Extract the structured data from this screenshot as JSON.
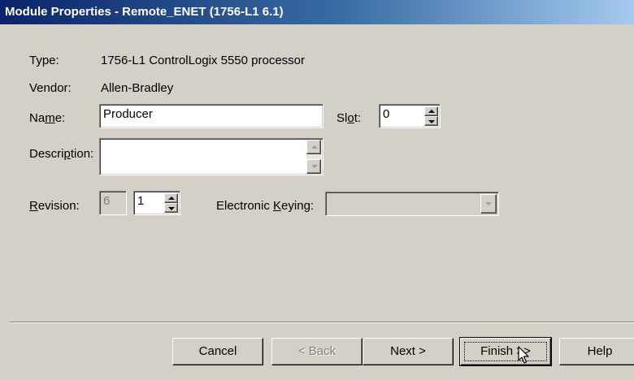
{
  "window": {
    "title": "Module Properties - Remote_ENET (1756-L1 6.1)"
  },
  "fields": {
    "type_label": "Type:",
    "type_value": "1756-L1 ControlLogix 5550 processor",
    "vendor_label": "Vendor:",
    "vendor_value": "Allen-Bradley",
    "name_label_pre": "Na",
    "name_label_key": "m",
    "name_label_post": "e:",
    "name_value": "Producer",
    "slot_label_pre": "Sl",
    "slot_label_key": "o",
    "slot_label_post": "t:",
    "slot_value": "0",
    "description_label_pre": "Descri",
    "description_label_key": "p",
    "description_label_post": "tion:",
    "description_value": "",
    "revision_label_key": "R",
    "revision_label_post": "evision:",
    "revision_major": "6",
    "revision_minor": "1",
    "keying_label_pre": "Electronic ",
    "keying_label_key": "K",
    "keying_label_post": "eying:",
    "keying_value": ""
  },
  "buttons": {
    "cancel": "Cancel",
    "back": "< Back",
    "next": "Next >",
    "finish": "Finish >>",
    "help": "Help"
  }
}
